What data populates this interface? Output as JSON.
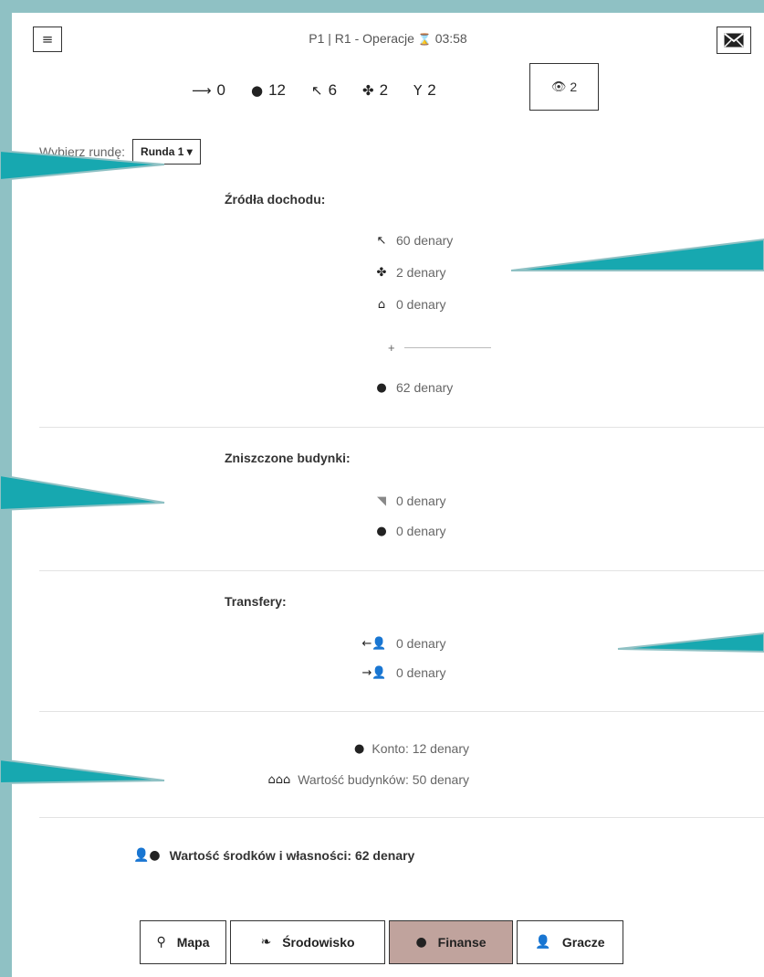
{
  "header": {
    "title": "P1 | R1 - Operacje",
    "timer_icon": "⌛",
    "timer": "03:58",
    "menu_icon": "≡"
  },
  "stats": [
    {
      "icon": "⟶",
      "value": "0"
    },
    {
      "icon": "●",
      "value": "12"
    },
    {
      "icon": "↖",
      "value": "6"
    },
    {
      "icon": "✤",
      "value": "2"
    },
    {
      "icon": "Y",
      "value": "2"
    }
  ],
  "eye": {
    "icon": "👁",
    "value": "2"
  },
  "round": {
    "label": "Wybierz rundę:",
    "value": "Runda 1 ▾"
  },
  "income": {
    "heading": "Źródła dochodu:",
    "items": [
      {
        "icon": "↖",
        "text": "60 denary"
      },
      {
        "icon": "✤",
        "text": "2 denary"
      },
      {
        "icon": "⌂",
        "text": "0 denary"
      }
    ],
    "plus": "+",
    "total": {
      "icon": "●",
      "text": "62 denary"
    }
  },
  "destroyed": {
    "heading": "Zniszczone budynki:",
    "items": [
      {
        "icon": "◥",
        "text": "0 denary"
      },
      {
        "icon": "●",
        "text": "0 denary"
      }
    ]
  },
  "transfers": {
    "heading": "Transfery:",
    "items": [
      {
        "icon": "←👤",
        "text": "0 denary"
      },
      {
        "icon": "→👤",
        "text": "0 denary"
      }
    ]
  },
  "summary": {
    "account": {
      "icon": "●",
      "label": "Konto: 12 denary"
    },
    "buildings": {
      "icon": "⌂⌂⌂",
      "label": "Wartość budynków: 50 denary"
    }
  },
  "total": {
    "icon": "👤●",
    "label": "Wartość środków i własności: 62 denary"
  },
  "nav": [
    {
      "icon": "⚲",
      "label": "Mapa",
      "active": false
    },
    {
      "icon": "❧",
      "label": "Środowisko",
      "active": false
    },
    {
      "icon": "●",
      "label": "Finanse",
      "active": true
    },
    {
      "icon": "👤",
      "label": "Gracze",
      "active": false
    }
  ],
  "colors": {
    "accent_teal": "#17a8b0",
    "active_tab": "#c0a39d",
    "frame": "#8fc1c4"
  }
}
